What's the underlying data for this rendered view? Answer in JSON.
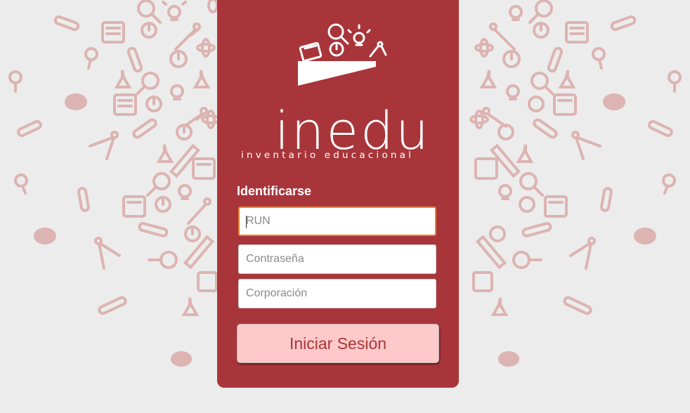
{
  "brand": {
    "name": "inedu",
    "tagline": "inventario educacional"
  },
  "login": {
    "heading": "Identificarse",
    "run_placeholder": "RUN",
    "password_placeholder": "Contraseña",
    "corporation_placeholder": "Corporación",
    "submit_label": "Iniciar Sesión"
  },
  "background_icons": [
    "calculator-icon",
    "magnifier-icon",
    "lightbulb-icon",
    "compass-icon",
    "clock-icon",
    "test-tube-icon",
    "flask-icon",
    "palette-icon",
    "ruler-icon",
    "atom-icon"
  ],
  "colors": {
    "card": "#a8353a",
    "page_background": "#ececec",
    "pattern": "#dcb4b2",
    "button": "#ffc9c9",
    "focus": "#e8842e"
  }
}
